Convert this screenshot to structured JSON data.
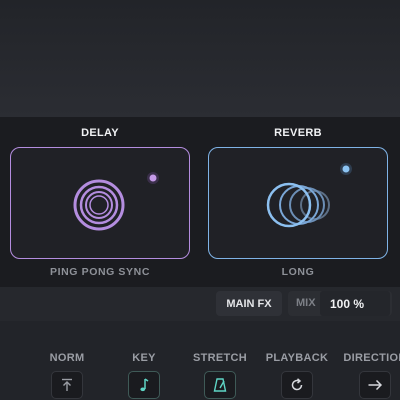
{
  "effects": {
    "delay": {
      "title": "DELAY",
      "mode": "PING PONG SYNC",
      "color": "#b48ddf",
      "icon": "concentric-rings-icon"
    },
    "reverb": {
      "title": "REVERB",
      "mode": "LONG",
      "color": "#7fb3e6",
      "icon": "overlapping-rings-icon"
    }
  },
  "mix_row": {
    "main_fx_label": "MAIN FX",
    "mix_label": "MIX",
    "mix_value": "100 %"
  },
  "controls": [
    {
      "label": "NORM",
      "icon": "upload-arrow-icon"
    },
    {
      "label": "KEY",
      "icon": "music-note-icon"
    },
    {
      "label": "STRETCH",
      "icon": "metronome-icon"
    },
    {
      "label": "PLAYBACK",
      "icon": "loop-icon"
    },
    {
      "label": "DIRECTION",
      "icon": "arrow-right-icon"
    }
  ],
  "colors": {
    "accent_teal": "#5fd6c6",
    "delay_purple": "#b48ddf",
    "reverb_blue": "#7fb3e6"
  }
}
